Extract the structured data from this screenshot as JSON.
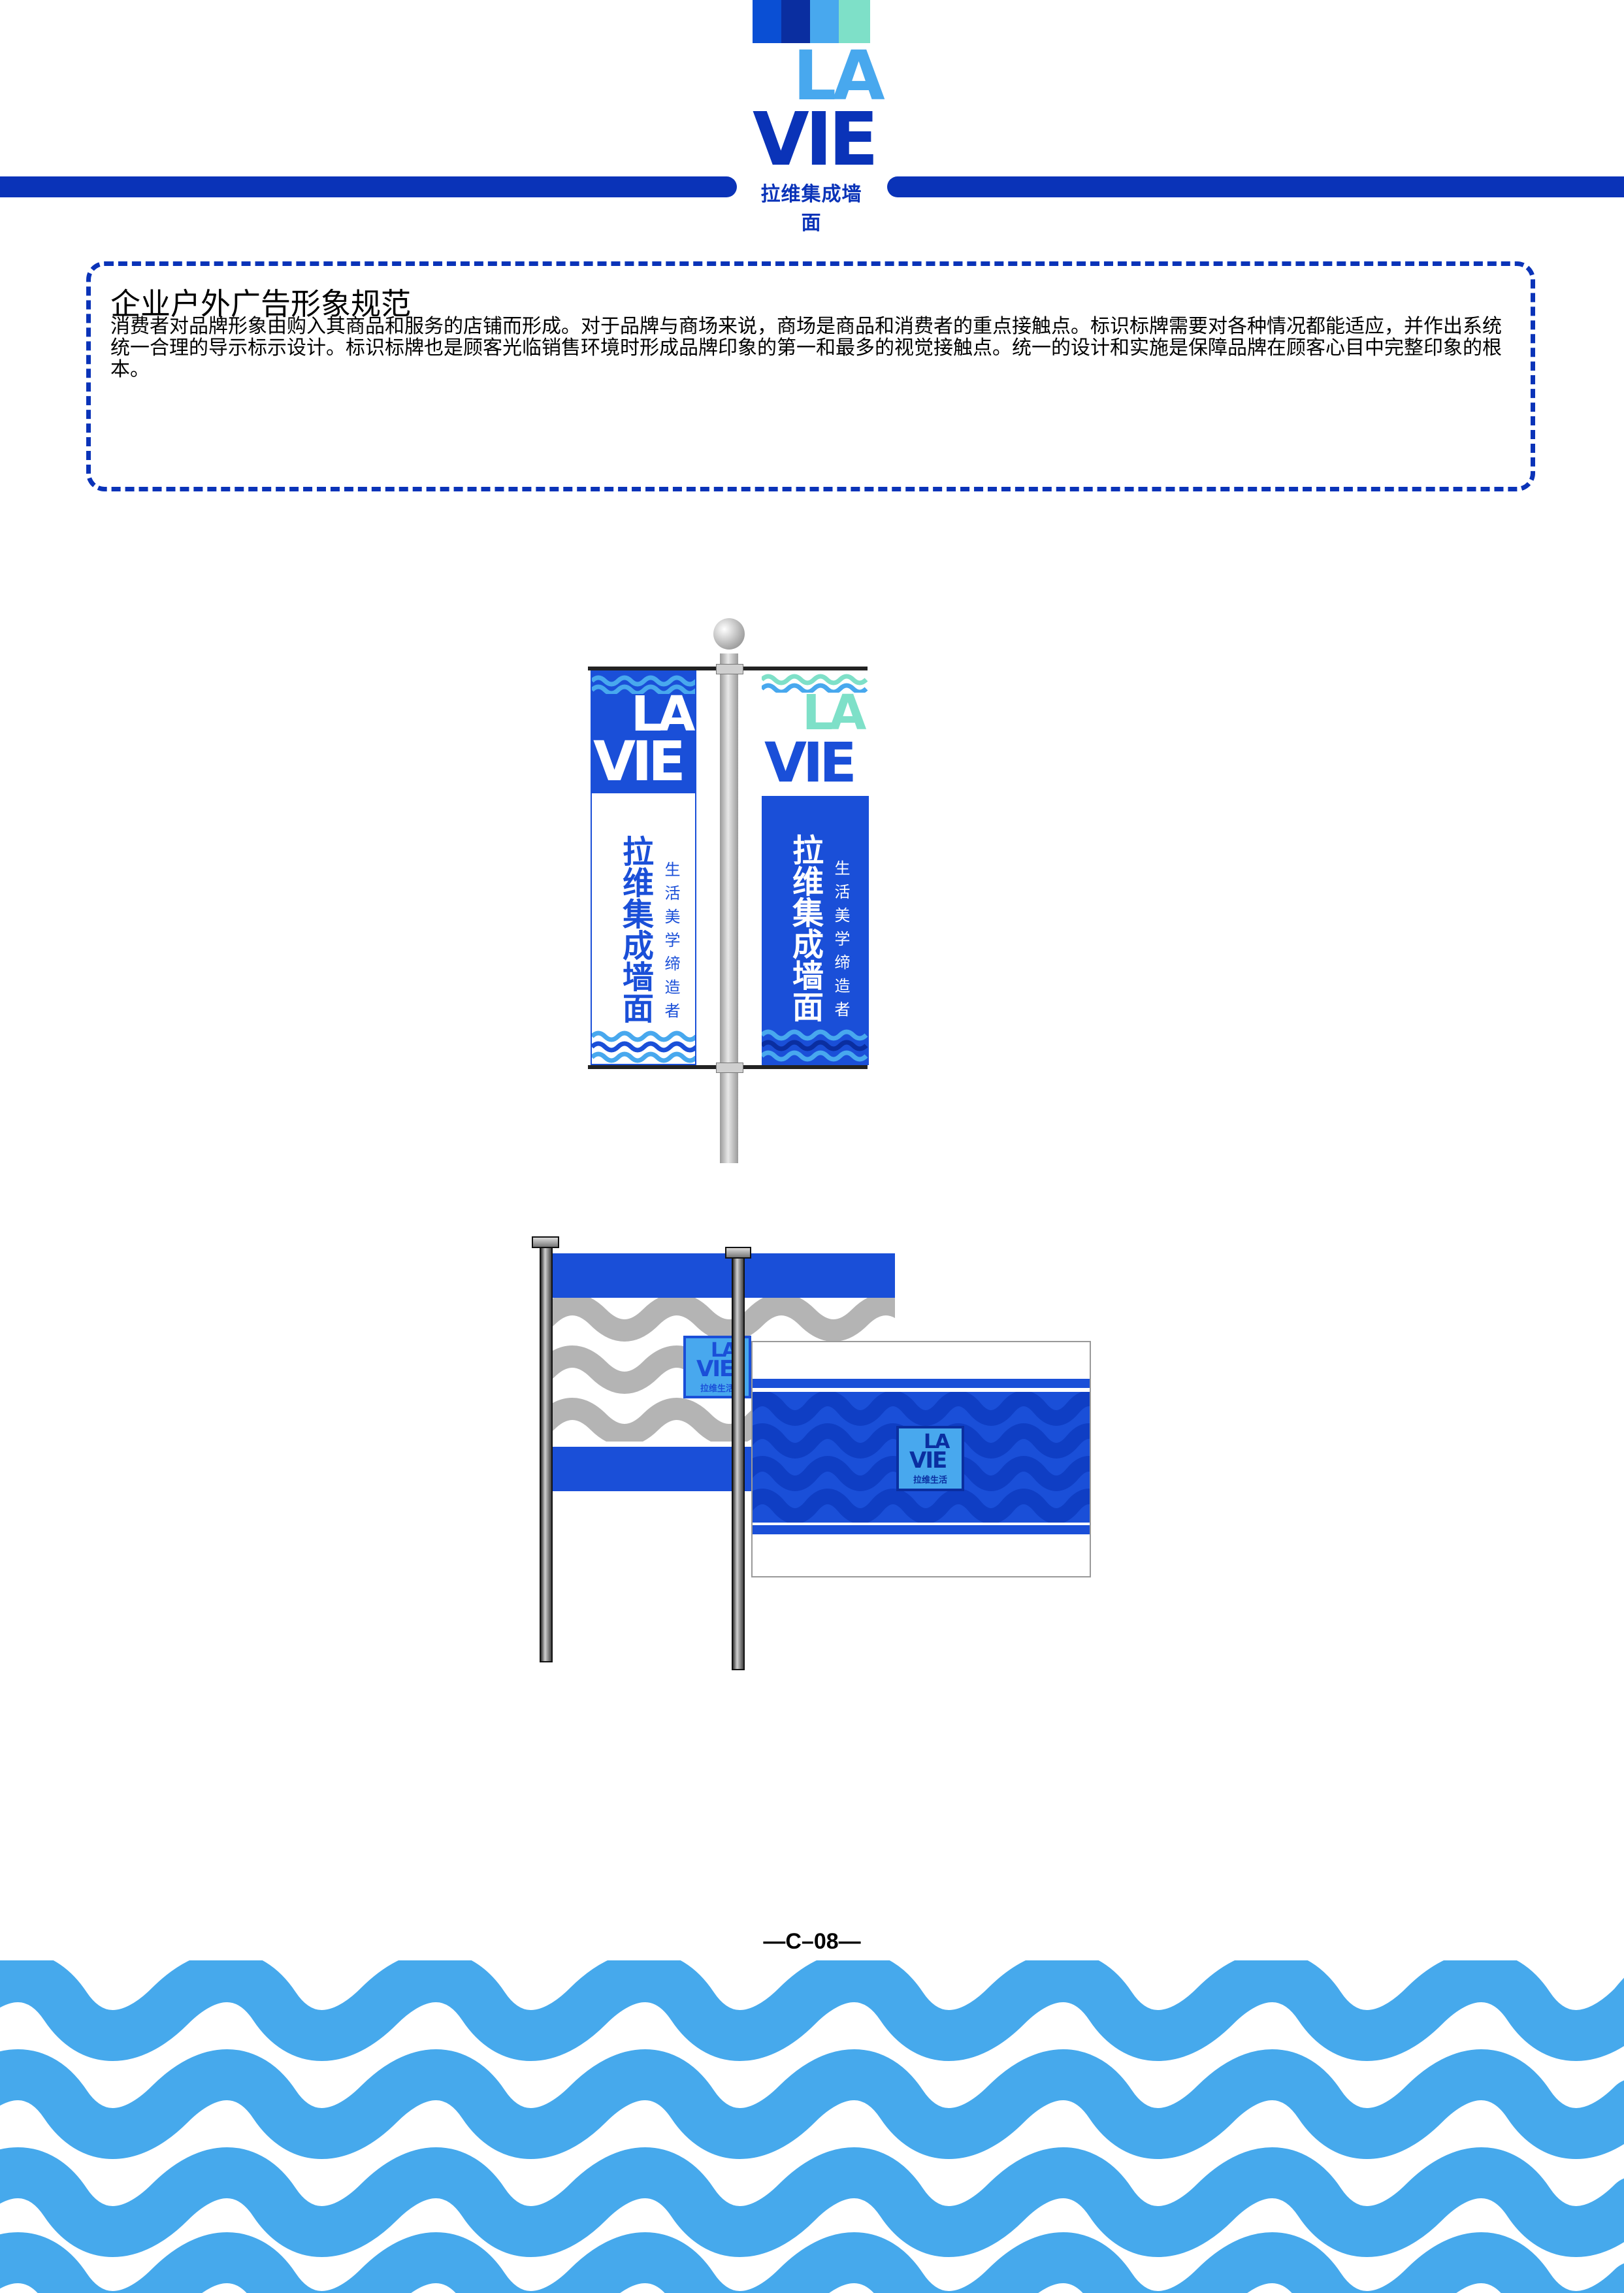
{
  "header": {
    "logo_top": "LA",
    "logo_bottom": "VIE",
    "logo_subtitle": "拉维集成墙面",
    "color_swatches": [
      "#0a4fd4",
      "#0a2ea0",
      "#48a8ee",
      "#7ee0c8"
    ]
  },
  "intro": {
    "title": "企业户外广告形象规范",
    "body": "消费者对品牌形象由购入其商品和服务的店铺而形成。对于品牌与商场来说，商场是商品和消费者的重点接触点。标识标牌需要对各种情况都能适应，并作出系统统一合理的导示标示设计。标识标牌也是顾客光临销售环境时形成品牌印象的第一和最多的视觉接触点。统一的设计和实施是保障品牌在顾客心目中完整印象的根本。"
  },
  "pole_banner": {
    "left": {
      "logo_top": "LA",
      "logo_bottom": "VIE",
      "name": "拉维集成墙面",
      "slogan": "生活美学缔造者"
    },
    "right": {
      "logo_top": "LA",
      "logo_bottom": "VIE",
      "name": "拉维集成墙面",
      "slogan": "生活美学缔造者"
    }
  },
  "flags": {
    "back": {
      "logo_top": "LA",
      "logo_bottom": "VIE",
      "sub": "拉维生活"
    },
    "front": {
      "logo_top": "LA",
      "logo_bottom": "VIE",
      "sub": "拉维生活"
    }
  },
  "footer": {
    "page_number": "—C–08—",
    "pattern_color": "#46a9ec"
  },
  "colors": {
    "brand_blue": "#0a33b8",
    "mid_blue": "#1a4fd8",
    "light_blue": "#46a9ec",
    "mint": "#7ee0c8"
  }
}
